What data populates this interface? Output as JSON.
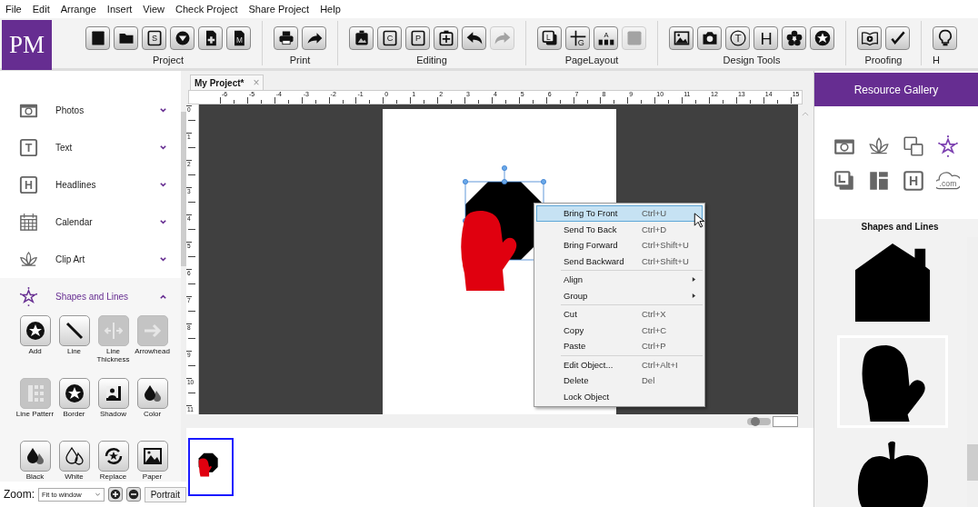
{
  "menu_bar": [
    "File",
    "Edit",
    "Arrange",
    "Insert",
    "View",
    "Check Project",
    "Share Project",
    "Help"
  ],
  "ribbon": {
    "logo": "PM",
    "groups": [
      {
        "label": "Project",
        "buttons": [
          {
            "disabled": false
          },
          {
            "disabled": false
          },
          {
            "glyph": "S",
            "disabled": false
          },
          {
            "disabled": false
          },
          {
            "disabled": false
          },
          {
            "glyph": "M",
            "disabled": false
          }
        ]
      },
      {
        "label": "Print",
        "buttons": [
          {
            "disabled": false
          },
          {
            "disabled": false
          }
        ]
      },
      {
        "label": "Editing",
        "buttons": [
          {
            "disabled": false
          },
          {
            "glyph": "C",
            "disabled": false
          },
          {
            "glyph": "P",
            "disabled": false
          },
          {
            "disabled": false
          },
          {
            "disabled": false
          },
          {
            "disabled": true
          }
        ]
      },
      {
        "label": "PageLayout",
        "buttons": [
          {
            "glyph": "L",
            "disabled": false
          },
          {
            "glyph": "G",
            "disabled": false
          },
          {
            "glyph": "A",
            "disabled": false
          },
          {
            "disabled": true
          }
        ]
      },
      {
        "label": "Design Tools",
        "buttons": [
          {
            "disabled": false
          },
          {
            "disabled": false
          },
          {
            "glyph": "T",
            "disabled": false
          },
          {
            "glyph": "H",
            "disabled": false
          },
          {
            "disabled": false
          },
          {
            "disabled": false
          }
        ]
      },
      {
        "label": "Proofing",
        "buttons": [
          {
            "disabled": false
          },
          {
            "disabled": false
          }
        ]
      },
      {
        "label": "H",
        "buttons": [
          {
            "disabled": false
          }
        ]
      }
    ]
  },
  "sidebar": {
    "sections": [
      {
        "label": "Photos",
        "expanded": false
      },
      {
        "label": "Text",
        "glyph": "T",
        "expanded": false
      },
      {
        "label": "Headlines",
        "glyph": "H",
        "expanded": false
      },
      {
        "label": "Calendar",
        "expanded": false
      },
      {
        "label": "Clip Art",
        "expanded": false
      },
      {
        "label": "Shapes and Lines",
        "expanded": true,
        "tools": [
          {
            "label": "Add",
            "disabled": false
          },
          {
            "label": "Line",
            "disabled": false
          },
          {
            "label": "Line Thickness",
            "disabled": true
          },
          {
            "label": "Arrowhead",
            "disabled": true
          },
          {
            "label": "Line Patterr",
            "disabled": true
          },
          {
            "label": "Border",
            "disabled": false
          },
          {
            "label": "Shadow",
            "disabled": false
          },
          {
            "label": "Color",
            "disabled": false
          },
          {
            "label": "Black",
            "disabled": false
          },
          {
            "label": "White",
            "disabled": false
          },
          {
            "label": "Replace",
            "disabled": false
          },
          {
            "label": "Paper",
            "disabled": false
          }
        ]
      }
    ]
  },
  "zoom": {
    "label": "Zoom:",
    "value": "Fit to window",
    "orientation": "Portrait"
  },
  "document_tab": {
    "title": "My Project*",
    "close": "×"
  },
  "rulers": {
    "horizontal": [
      "-6",
      "-5",
      "-4",
      "-3",
      "-2",
      "-1",
      "0",
      "1",
      "2",
      "3",
      "4",
      "5",
      "6",
      "7",
      "8",
      "9",
      "10",
      "11",
      "12",
      "13",
      "14",
      "15"
    ],
    "vertical": [
      "0",
      "1",
      "2",
      "3",
      "4",
      "5",
      "6",
      "7",
      "8",
      "9",
      "10",
      "11"
    ]
  },
  "zoom_slider": {
    "level": 0.2
  },
  "context_menu": {
    "groups": [
      [
        {
          "label": "Bring To Front",
          "shortcut": "Ctrl+U",
          "selected": true
        },
        {
          "label": "Send To Back",
          "shortcut": "Ctrl+D",
          "selected": false
        },
        {
          "label": "Bring Forward",
          "shortcut": "Ctrl+Shift+U",
          "selected": false
        },
        {
          "label": "Send Backward",
          "shortcut": "Ctrl+Shift+U",
          "selected": false
        }
      ],
      [
        {
          "label": "Align",
          "submenu": true,
          "selected": false
        },
        {
          "label": "Group",
          "submenu": true,
          "selected": false
        }
      ],
      [
        {
          "label": "Cut",
          "shortcut": "Ctrl+X",
          "selected": false
        },
        {
          "label": "Copy",
          "shortcut": "Ctrl+C",
          "selected": false
        },
        {
          "label": "Paste",
          "shortcut": "Ctrl+P",
          "selected": false
        }
      ],
      [
        {
          "label": "Edit Object...",
          "shortcut": "Ctrl+Alt+I",
          "selected": false
        },
        {
          "label": "Delete",
          "shortcut": "Del",
          "selected": false
        },
        {
          "label": "Lock Object",
          "selected": false
        }
      ]
    ]
  },
  "thumbnails": [
    {
      "selected": true
    }
  ],
  "resource_gallery": {
    "title": "Resource Gallery",
    "categories": [
      {
        "selected": false
      },
      {
        "selected": false
      },
      {
        "selected": false
      },
      {
        "selected": true
      },
      {
        "selected": false
      },
      {
        "selected": false
      },
      {
        "glyph": "H",
        "selected": false
      },
      {
        "glyph": ".com",
        "selected": false
      }
    ],
    "section_title": "Shapes and Lines",
    "shapes": [
      {
        "kind": "house",
        "selected": false
      },
      {
        "kind": "mitten",
        "selected": true
      },
      {
        "kind": "apple",
        "selected": false
      }
    ]
  }
}
